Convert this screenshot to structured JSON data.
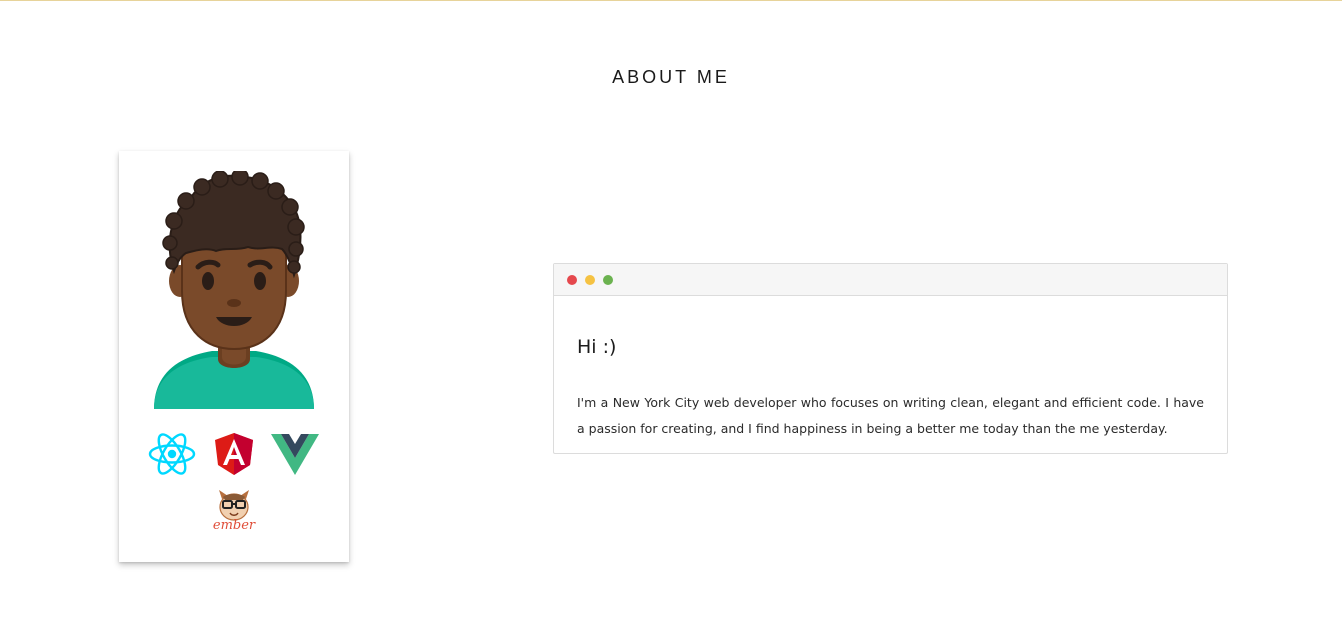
{
  "section": {
    "title": "ABOUT ME"
  },
  "profile": {
    "avatar_icon": "man-avatar-emoji-icon",
    "tech_icons": [
      "react-logo-icon",
      "angular-logo-icon",
      "vue-logo-icon",
      "ember-logo-icon"
    ]
  },
  "about": {
    "greeting": "Hi :)",
    "bio": "I'm a New York City web developer who focuses on writing clean, elegant and efficient code. I have a passion for creating, and I find happiness in being a better me today than the me yesterday."
  },
  "browser": {
    "dot_colors": [
      "#e5484d",
      "#f5c242",
      "#6bb24f"
    ]
  },
  "colors": {
    "accent_rule": "#e7d39a",
    "react": "#00d8ff",
    "angular": "#dd1b16",
    "vue_green": "#41b883",
    "vue_dark": "#34495e",
    "shirt": "#00a985"
  }
}
